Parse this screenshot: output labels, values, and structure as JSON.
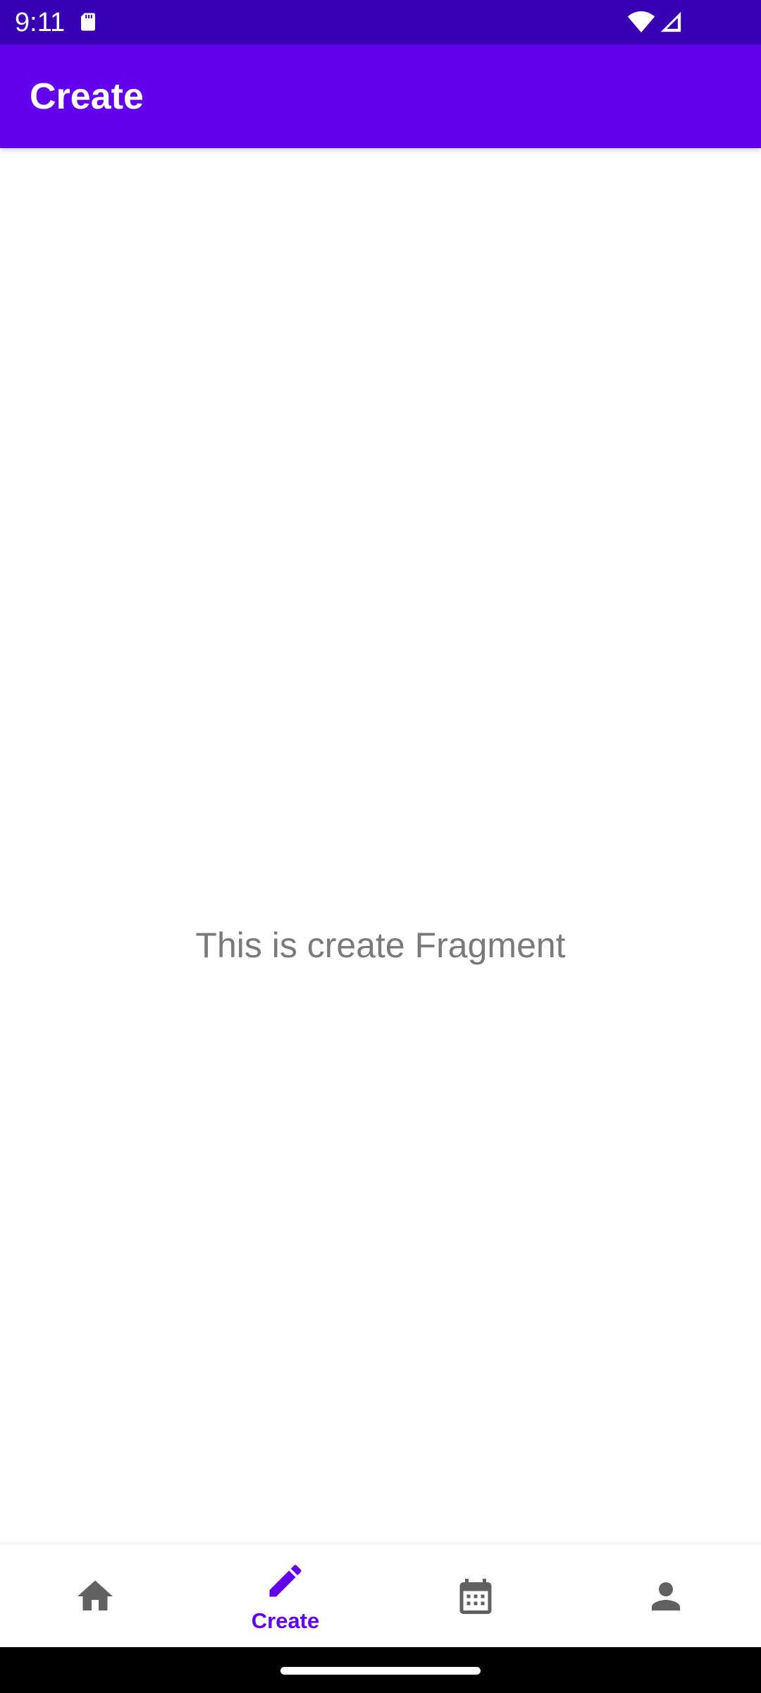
{
  "status_bar": {
    "time": "9:11",
    "icons": [
      "sd-card-icon",
      "wifi-icon",
      "signal-icon"
    ]
  },
  "app_bar": {
    "title": "Create"
  },
  "content": {
    "message": "This is create Fragment"
  },
  "bottom_nav": {
    "items": [
      {
        "id": "home",
        "icon": "home-icon",
        "label": "",
        "active": false
      },
      {
        "id": "create",
        "icon": "pencil-icon",
        "label": "Create",
        "active": true
      },
      {
        "id": "calendar",
        "icon": "calendar-icon",
        "label": "",
        "active": false
      },
      {
        "id": "profile",
        "icon": "person-icon",
        "label": "",
        "active": false
      }
    ]
  },
  "colors": {
    "status_bar": "#3700b3",
    "primary": "#6200ee",
    "inactive_icon": "#616161",
    "body_text": "#7a7a7a",
    "system_bar": "#000000"
  }
}
